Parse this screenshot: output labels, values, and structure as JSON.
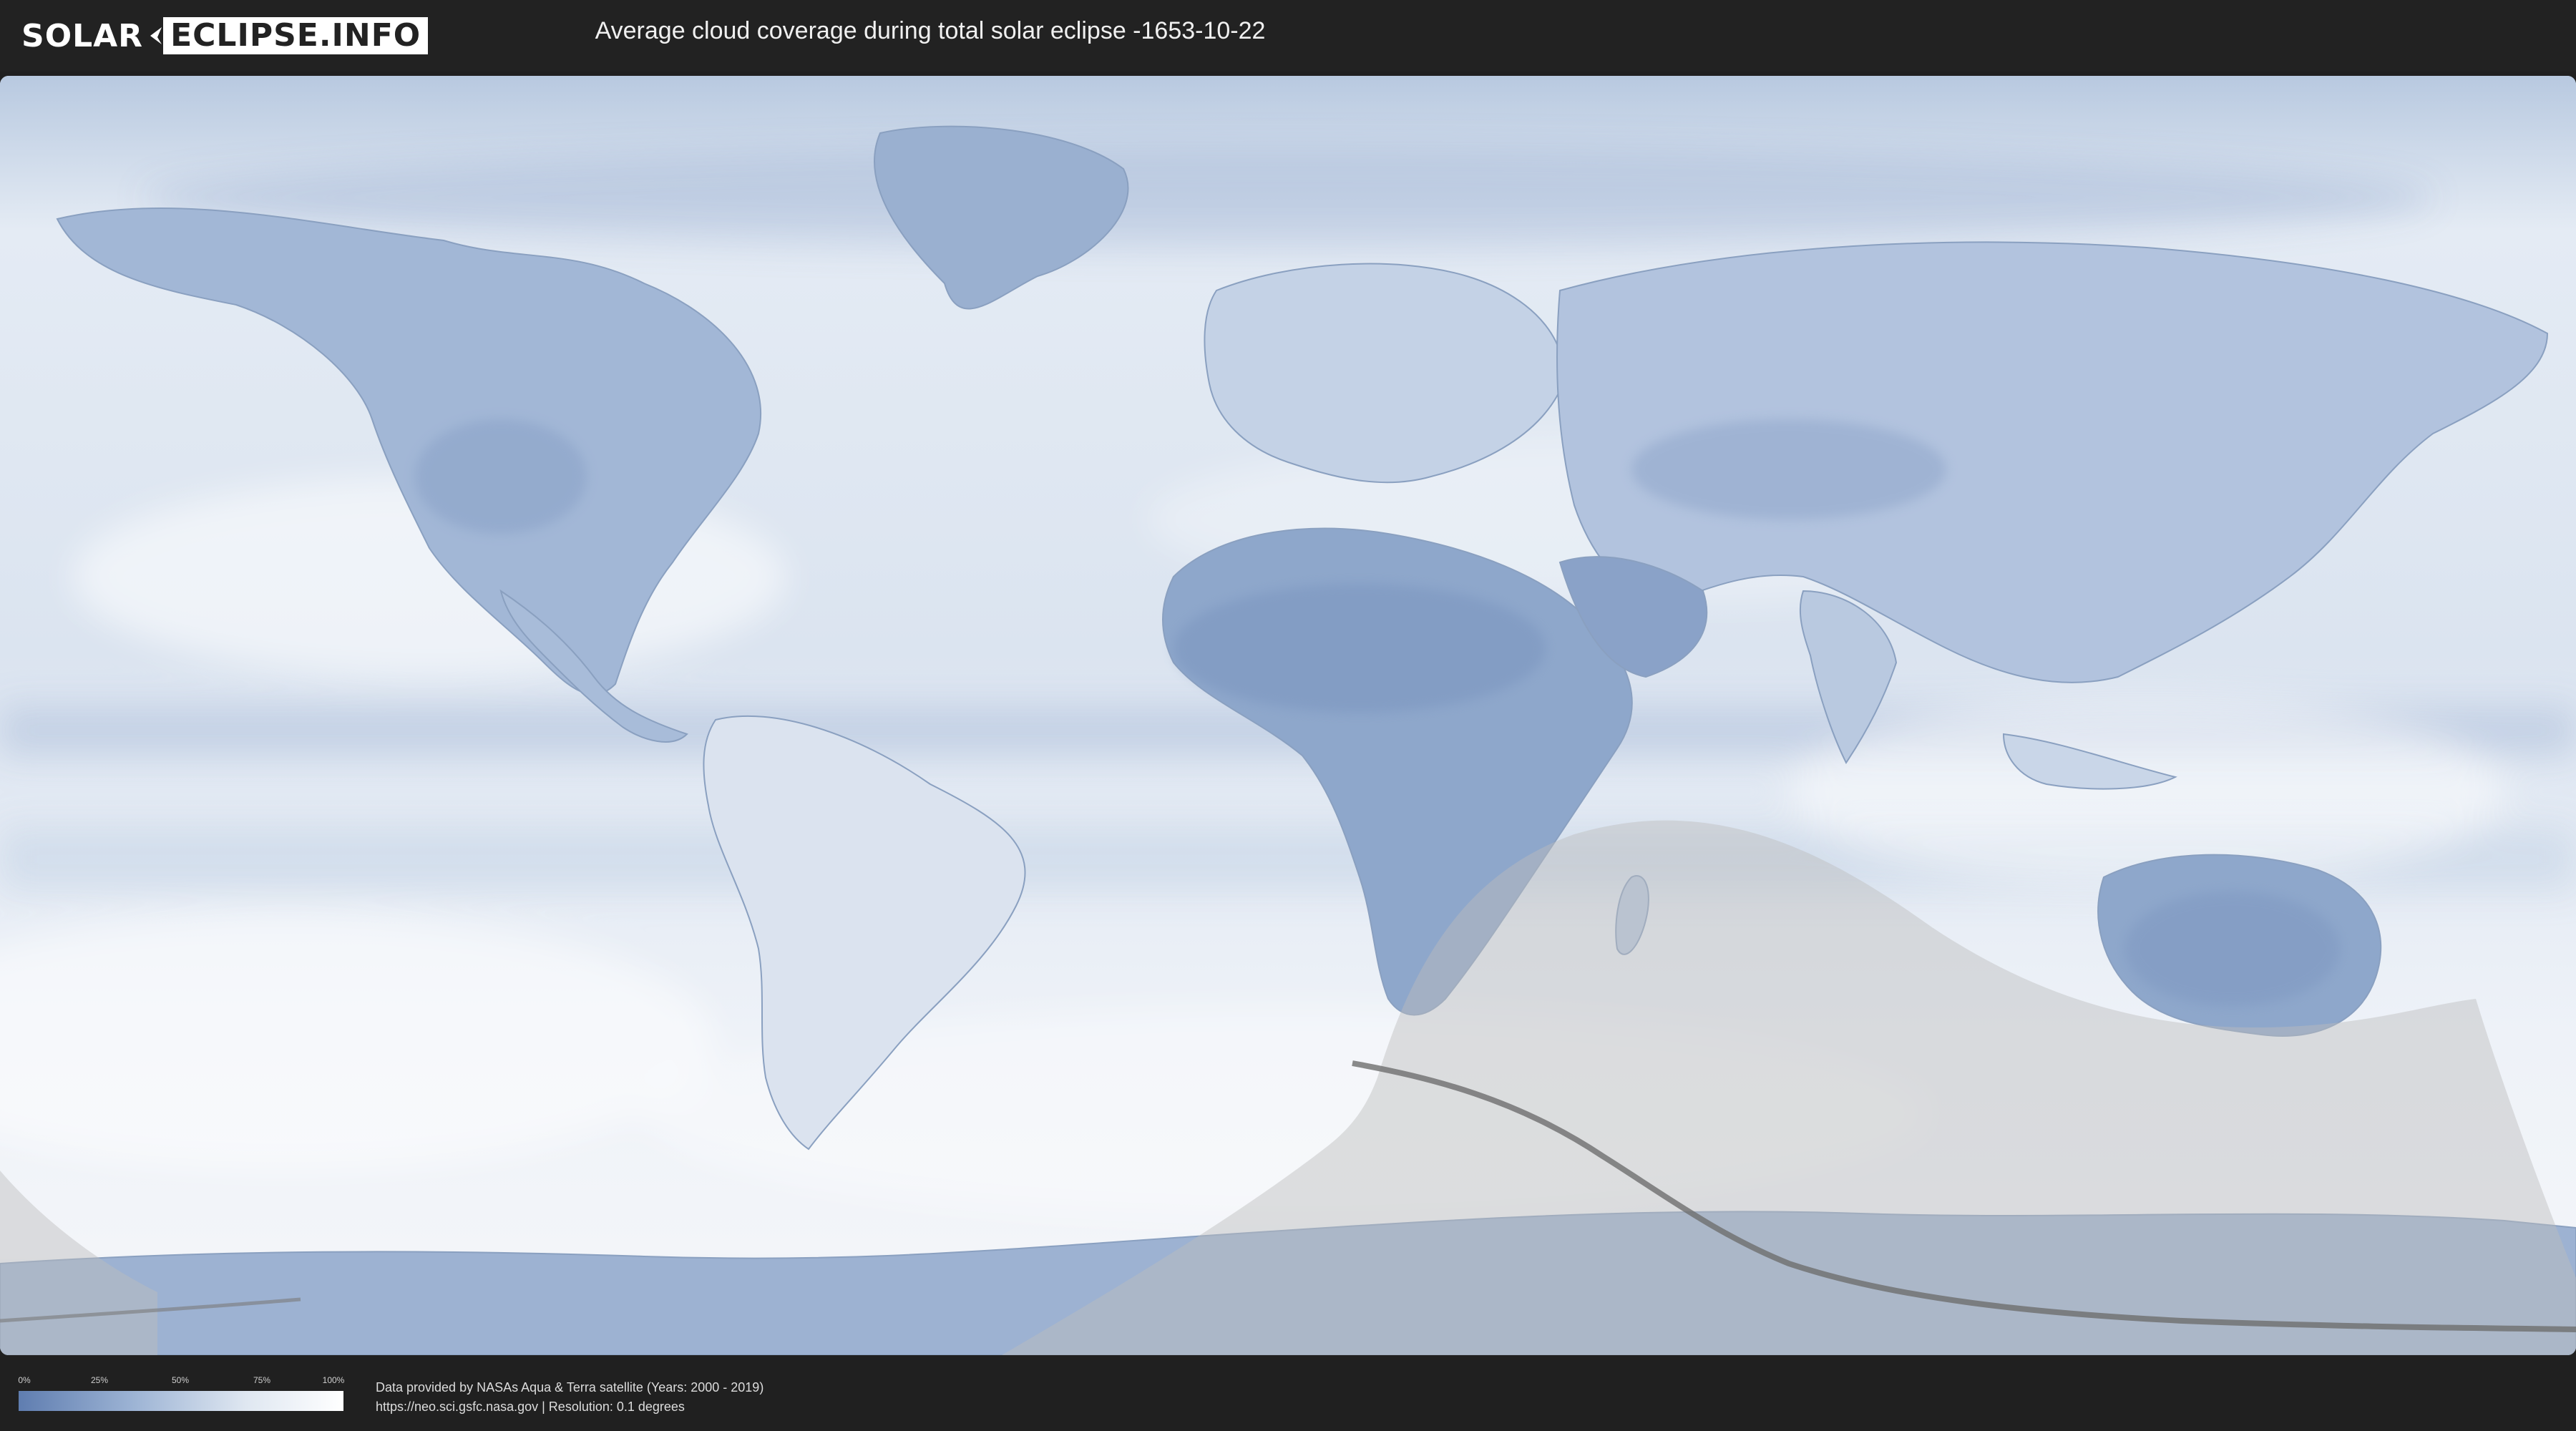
{
  "header": {
    "logo_left": "SOLAR",
    "logo_right": "ECLIPSE.INFO",
    "title": "Average cloud coverage during total solar eclipse -1653-10-22"
  },
  "map": {
    "icon": "world-cloud-map",
    "colors": {
      "clear": "#5f7db0",
      "cloudy": "#ffffff",
      "shadow_zone": "#bdbdbd",
      "totality_path": "#6e6e6e"
    }
  },
  "legend": {
    "ticks": [
      "0%",
      "25%",
      "50%",
      "75%",
      "100%"
    ]
  },
  "footer": {
    "credit_line1": "Data provided by NASAs Aqua & Terra satellite (Years: 2000 - 2019)",
    "credit_line2": "https://neo.sci.gsfc.nasa.gov | Resolution: 0.1 degrees"
  }
}
